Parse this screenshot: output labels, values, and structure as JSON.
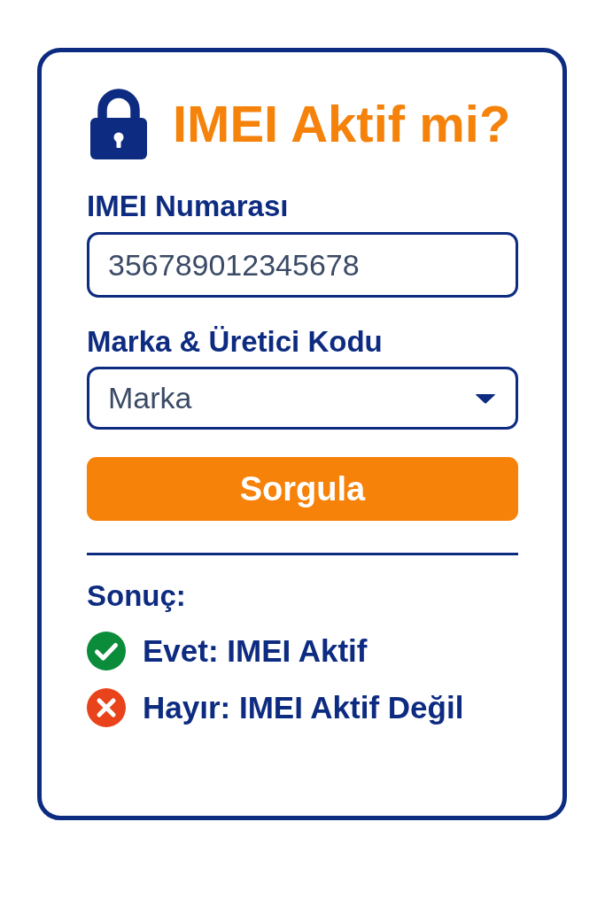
{
  "header": {
    "title": "IMEI Aktif mi?"
  },
  "form": {
    "imei_field": {
      "label": "IMEI Numarası",
      "value": "356789012345678"
    },
    "brand_select": {
      "label": "Marka & Üretici Kodu",
      "value": "Marka"
    },
    "submit_button": "Sorgula"
  },
  "result": {
    "heading": "Sonuç:",
    "items": [
      {
        "kind": "success",
        "color": "#0a8c3a",
        "text": "Evet: IMEI Aktif"
      },
      {
        "kind": "error",
        "color": "#e8431a",
        "text": "Hayır: IMEI Aktif Değil"
      }
    ]
  }
}
